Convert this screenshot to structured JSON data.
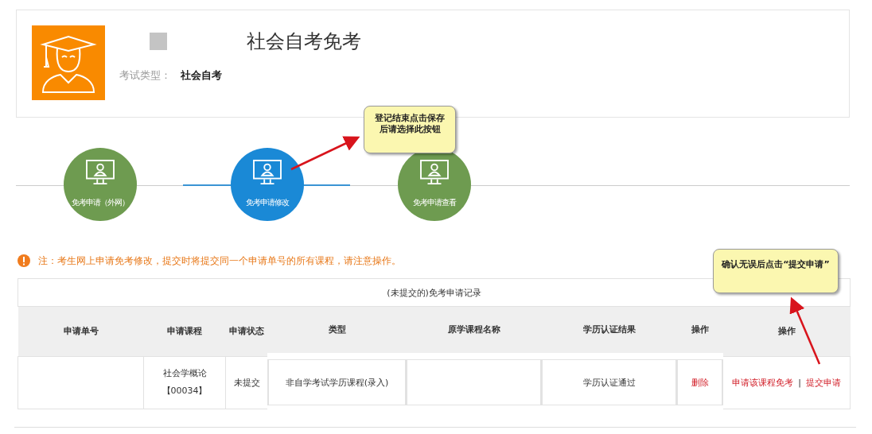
{
  "header": {
    "title": "社会自考免考",
    "exam_type_label": "考试类型：",
    "exam_type": "社会自考"
  },
  "steps": [
    {
      "label": "免考申请（外网）",
      "selected": false
    },
    {
      "label": "免考申请修改",
      "selected": true
    },
    {
      "label": "免考申请查看",
      "selected": false
    }
  ],
  "callouts": [
    {
      "text": "登记结束点击保存后请选择此按钮"
    },
    {
      "text": "确认无误后点击“提交申请”"
    }
  ],
  "notice": "注：考生网上申请免考修改，提交时将提交同一个申请单号的所有课程，请注意操作。",
  "table": {
    "title": "(未提交的)免考申请记录",
    "columns": [
      "申请单号",
      "申请课程",
      "申请状态",
      "类型",
      "原学课程名称",
      "学历认证结果",
      "操作",
      "操作"
    ],
    "rows": [
      {
        "course": "社会学概论",
        "course_code": "【00034】",
        "status": "未提交",
        "type": "非自学考试学历课程(录入)",
        "verification": "学历认证通过",
        "delete": "删除",
        "actions": [
          "申请该课程免考",
          "提交申请"
        ],
        "action_separator": "|"
      }
    ]
  }
}
